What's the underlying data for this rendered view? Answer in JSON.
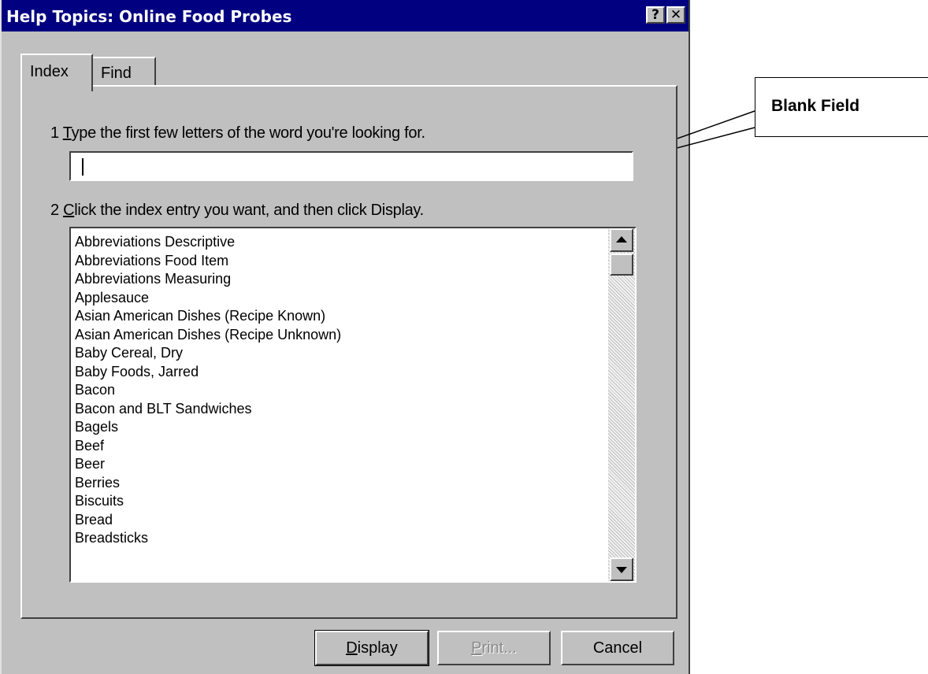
{
  "window": {
    "title": "Help Topics: Online Food Probes",
    "help_button": "?",
    "close_button": "✕"
  },
  "tabs": [
    {
      "label": "Index",
      "active": true
    },
    {
      "label": "Find",
      "active": false
    }
  ],
  "step1": {
    "number": "1",
    "accel": "T",
    "rest": "ype the first few letters of the word you're looking for."
  },
  "search": {
    "value": ""
  },
  "step2": {
    "number": "2",
    "accel": "C",
    "rest": "lick the index entry you want, and then click Display."
  },
  "index_entries": [
    "Abbreviations Descriptive",
    "Abbreviations Food Item",
    "Abbreviations Measuring",
    "Applesauce",
    "Asian American Dishes (Recipe Known)",
    "Asian American Dishes (Recipe Unknown)",
    "Baby Cereal, Dry",
    "Baby Foods, Jarred",
    "Bacon",
    "Bacon and BLT Sandwiches",
    "Bagels",
    "Beef",
    "Beer",
    "Berries",
    "Biscuits",
    "Bread",
    "Breadsticks"
  ],
  "buttons": {
    "display": {
      "accel": "D",
      "rest": "isplay"
    },
    "print": {
      "accel": "P",
      "rest": "rint..."
    },
    "cancel": "Cancel"
  },
  "callout": {
    "label": "Blank Field"
  },
  "colors": {
    "titlebar": "#000080",
    "face": "#c0c0c0",
    "disabled_text": "#8a8a8a"
  }
}
